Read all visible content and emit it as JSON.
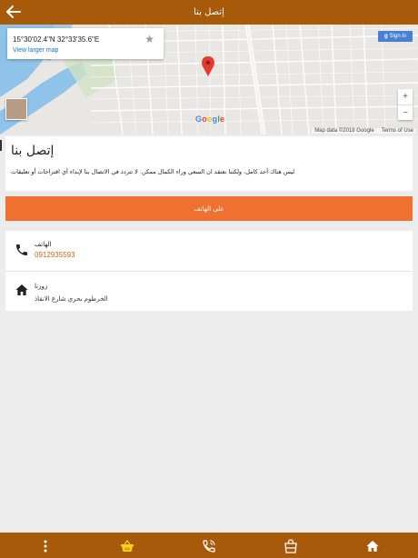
{
  "header": {
    "title": "إتصل بنا"
  },
  "map": {
    "coordinates": "15°30'02.4\"N 32°33'35.6\"E",
    "larger_map_link": "View larger map",
    "sign_in": "Sign in",
    "zoom_in": "+",
    "zoom_out": "−",
    "google_logo": "Google",
    "attribution": "Map data ©2018 Google",
    "terms": "Terms of Use"
  },
  "content": {
    "title": "إتصل بنا",
    "description": "ليس هناك أحد كامل، ولكننا نعتقد ان السعي وراء الكمال ممكن. لا تتردد في الاتصال بنا لإبداء أي اقتراحات أو تعليقات"
  },
  "call_button": {
    "label": "على الهاتف"
  },
  "contact": {
    "phone_label": "الهاتف",
    "phone_value": "0912935593",
    "visit_label": "زورنا",
    "visit_value": "الخرطوم بحري شارع الانقاذ"
  },
  "colors": {
    "brand": "#a65a0a",
    "accent": "#f07030",
    "link": "#c8661a"
  },
  "bottom_nav": {
    "icons": [
      "more-vertical-icon",
      "basket-icon",
      "phone-call-icon",
      "shopping-bag-icon",
      "home-icon"
    ]
  }
}
